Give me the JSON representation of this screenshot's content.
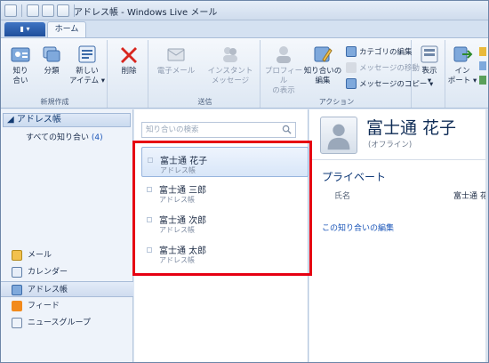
{
  "window": {
    "title": "アドレス帳 - Windows Live メール"
  },
  "tabs": {
    "app_menu": "▮ ▾",
    "home": "ホーム"
  },
  "ribbon": {
    "new_group": {
      "label": "新規作成",
      "buttons": [
        "知り\n合い",
        "分類",
        "新しい\nアイテム ▾"
      ]
    },
    "delete_label": "削除",
    "send_group": {
      "label": "送信",
      "buttons": [
        "電子メール",
        "インスタント\nメッセージ"
      ]
    },
    "action_group": {
      "label": "アクション",
      "buttons": [
        "プロフィール\nの表示",
        "知り合いの\n編集"
      ],
      "small": [
        "カテゴリの編集",
        "メッセージの移動 ▾",
        "メッセージのコピー ▾"
      ]
    },
    "view_label": "表示\n▾",
    "import_label": "イン\nポート ▾"
  },
  "left_pane": {
    "header": "アドレス帳",
    "all_contacts": "すべての知り合い",
    "all_contacts_count": "(4)",
    "nav": [
      "メール",
      "カレンダー",
      "アドレス帳",
      "フィード",
      "ニュースグループ"
    ]
  },
  "contacts_pane": {
    "search_placeholder": "知り合いの検索",
    "contacts": [
      {
        "name": "富士通 花子",
        "sub": "アドレス帳"
      },
      {
        "name": "富士通 三郎",
        "sub": "アドレス帳"
      },
      {
        "name": "富士通 次郎",
        "sub": "アドレス帳"
      },
      {
        "name": "富士通 太郎",
        "sub": "アドレス帳"
      }
    ]
  },
  "detail_pane": {
    "name": "富士通 花子",
    "status": "(オフライン)",
    "section": "プライベート",
    "field_label": "氏名",
    "field_value": "富士通 花",
    "edit_link": "この知り合いの編集"
  },
  "colors": {
    "highlight_border": "#e60012",
    "accent": "#1a55b8"
  }
}
